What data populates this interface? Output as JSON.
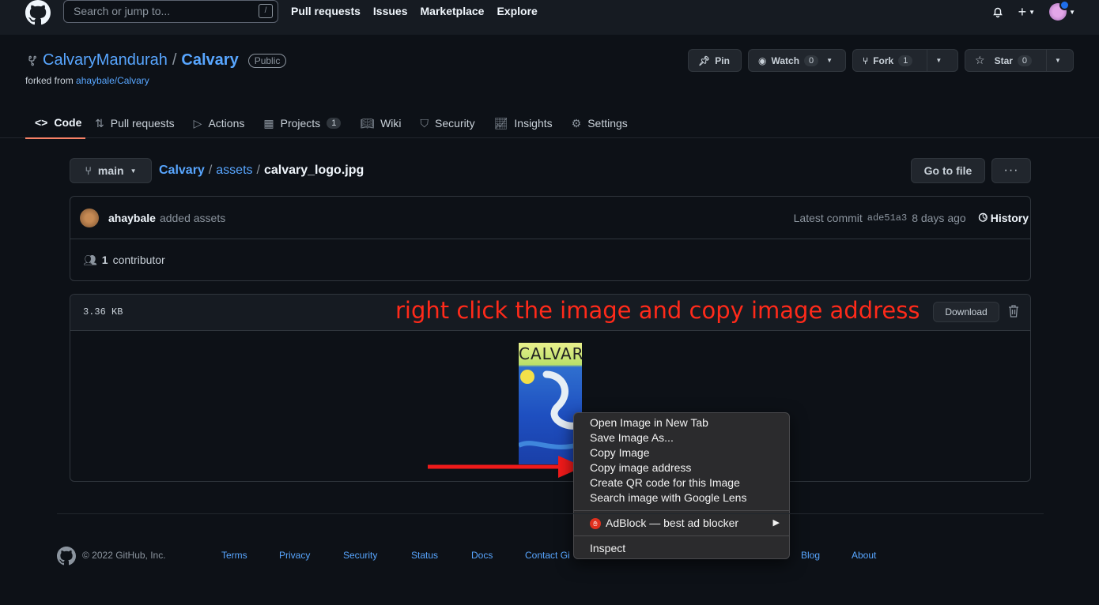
{
  "header": {
    "search_placeholder": "Search or jump to...",
    "slash": "/",
    "nav": [
      "Pull requests",
      "Issues",
      "Marketplace",
      "Explore"
    ],
    "plus": "+"
  },
  "repo": {
    "owner": "CalvaryMandurah",
    "separator": "/",
    "name": "Calvary",
    "visibility": "Public",
    "forked_from_prefix": "forked from",
    "forked_from": "ahaybale/Calvary",
    "pin_label": "Pin",
    "watch_label": "Watch",
    "watch_count": "0",
    "fork_label": "Fork",
    "fork_count": "1",
    "star_label": "Star",
    "star_count": "0"
  },
  "tabs": [
    {
      "label": "Code",
      "icon": "code-icon",
      "active": true
    },
    {
      "label": "Pull requests",
      "icon": "pull-request-icon"
    },
    {
      "label": "Actions",
      "icon": "play-icon"
    },
    {
      "label": "Projects",
      "icon": "table-icon",
      "count": "1"
    },
    {
      "label": "Wiki",
      "icon": "book-icon"
    },
    {
      "label": "Security",
      "icon": "shield-icon"
    },
    {
      "label": "Insights",
      "icon": "graph-icon"
    },
    {
      "label": "Settings",
      "icon": "gear-icon"
    }
  ],
  "file_nav": {
    "branch": "main",
    "crumbs": [
      "Calvary",
      "assets",
      "calvary_logo.jpg"
    ],
    "sep": "/",
    "go_to_file": "Go to file",
    "more": "···"
  },
  "commit": {
    "author": "ahaybale",
    "message": "added assets",
    "latest_label": "Latest commit",
    "sha": "ade51a3",
    "when": "8 days ago",
    "history": "History",
    "contributors_count": "1",
    "contributors_label": "contributor"
  },
  "file": {
    "size": "3.36 KB",
    "annotation": "right click the image and copy image address",
    "download": "Download",
    "logo_text": "CALVARY"
  },
  "context_menu": {
    "items": [
      "Open Image in New Tab",
      "Save Image As...",
      "Copy Image",
      "Copy image address",
      "Create QR code for this Image",
      "Search image with Google Lens"
    ],
    "adblock": "AdBlock — best ad blocker",
    "inspect": "Inspect"
  },
  "footer": {
    "copyright": "© 2022 GitHub, Inc.",
    "links": [
      "Terms",
      "Privacy",
      "Security",
      "Status",
      "Docs",
      "Contact Gi",
      "Blog",
      "About"
    ]
  },
  "colors": {
    "background": "#0d1117",
    "link": "#58a6ff",
    "annotation": "#ff2a1a",
    "active_tab_underline": "#f78166"
  }
}
